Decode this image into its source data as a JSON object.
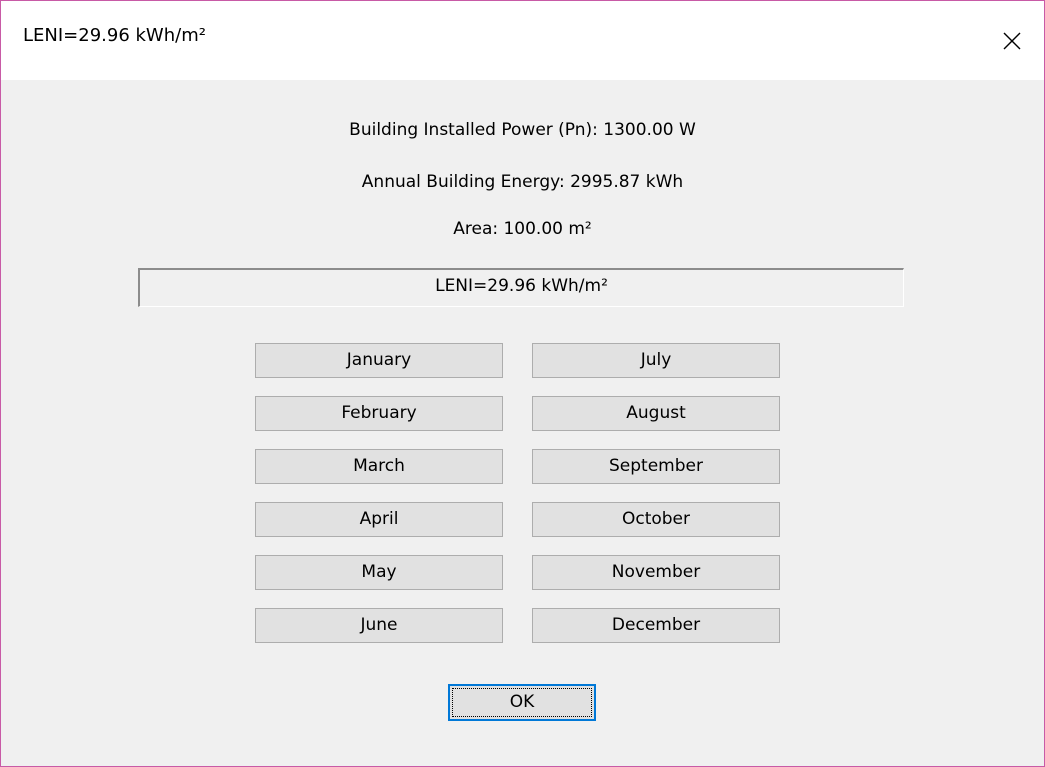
{
  "window": {
    "title": "LENI=29.96 kWh/m²",
    "close_icon": "close-icon"
  },
  "info": {
    "installed_power": "Building Installed Power (Pn): 1300.00 W",
    "annual_energy": "Annual Building Energy: 2995.87 kWh",
    "area": "Area: 100.00 m²"
  },
  "result": {
    "leni": "LENI=29.96 kWh/m²"
  },
  "months": {
    "left": [
      "January",
      "February",
      "March",
      "April",
      "May",
      "June"
    ],
    "right": [
      "July",
      "August",
      "September",
      "October",
      "November",
      "December"
    ]
  },
  "ok_label": "OK",
  "colors": {
    "window_border": "#c85aa6",
    "dialog_bg": "#f0f0f0",
    "button_bg": "#e1e1e1",
    "focus_border": "#0078d7"
  }
}
